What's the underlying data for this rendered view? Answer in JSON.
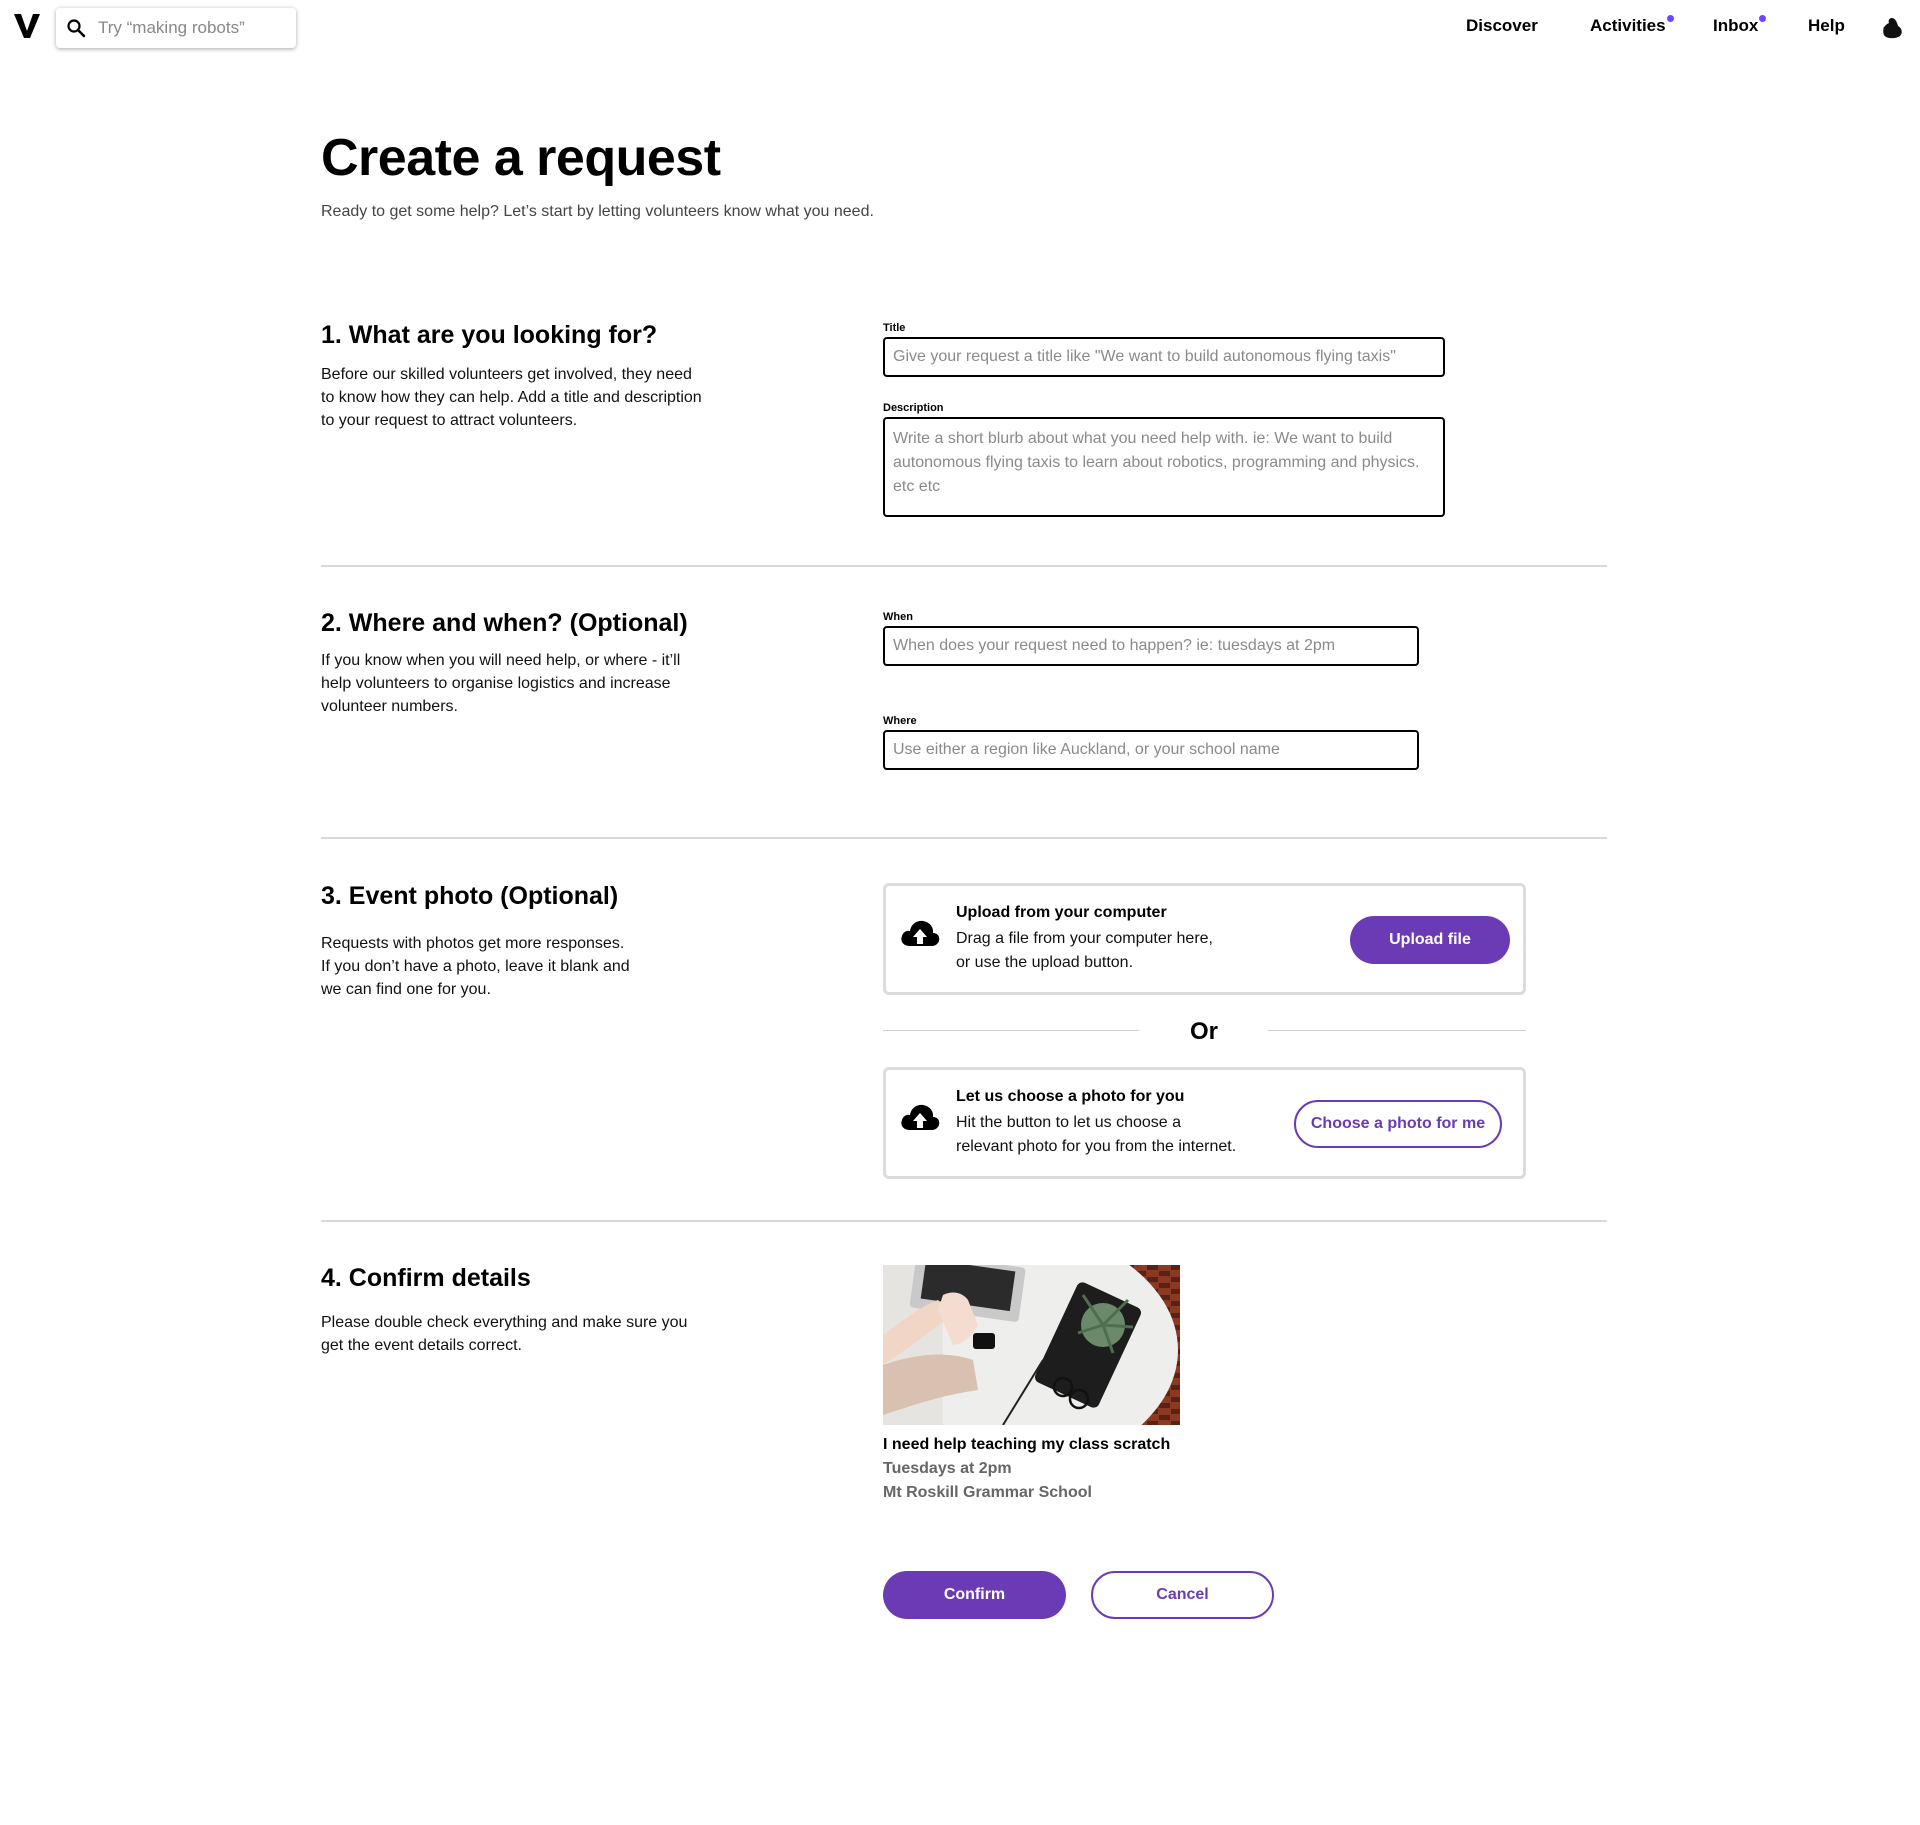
{
  "search": {
    "placeholder": "Try “making robots”"
  },
  "nav": {
    "discover": "Discover",
    "activities": "Activities",
    "inbox": "Inbox",
    "help": "Help"
  },
  "accent_color": "#6a3bb5",
  "header": {
    "title": "Create a request",
    "subtitle": "Ready to get some help? Let’s start by letting volunteers know what you need."
  },
  "section1": {
    "title": "1. What are you looking for?",
    "desc": [
      "Before our skilled volunteers get involved, they need",
      "to know how they can help. Add a title and description",
      "to your request to attract volunteers."
    ],
    "title_label": "Title",
    "title_placeholder": "Give your request a title like \"We want to build autonomous flying taxis\"",
    "desc_label": "Description",
    "desc_placeholder": "Write a short blurb about what you need help with. ie: We want to build autonomous flying taxis to learn about robotics, programming and physics. etc etc"
  },
  "section2": {
    "title": "2. Where and when? (Optional)",
    "desc": [
      "If you know when you will need help, or where - it’ll",
      "help volunteers to organise logistics and increase",
      "volunteer numbers."
    ],
    "when_label": "When",
    "when_placeholder": "When does your request need to happen? ie: tuesdays at 2pm",
    "where_label": "Where",
    "where_placeholder": "Use either a region like Auckland, or your school name"
  },
  "section3": {
    "title": "3. Event photo (Optional)",
    "desc": [
      "Requests with photos get more responses.",
      "If you don’t have a photo, leave it blank and",
      "we can find one for you."
    ],
    "upload": {
      "title": "Upload from your computer",
      "lines": [
        "Drag a file from your computer here,",
        "or use the upload button."
      ],
      "button": "Upload file"
    },
    "or": "Or",
    "choose": {
      "title": "Let us choose a photo for you",
      "lines": [
        "Hit the button to let us choose a",
        "relevant photo for you from the internet."
      ],
      "button": "Choose a photo for me"
    }
  },
  "section4": {
    "title": "4. Confirm details",
    "desc": [
      "Please double check everything and make sure you",
      "get the event details correct."
    ],
    "preview": {
      "title": "I need help teaching my class scratch",
      "when": "Tuesdays at 2pm",
      "where": "Mt Roskill Grammar School"
    },
    "confirm": "Confirm",
    "cancel": "Cancel"
  }
}
